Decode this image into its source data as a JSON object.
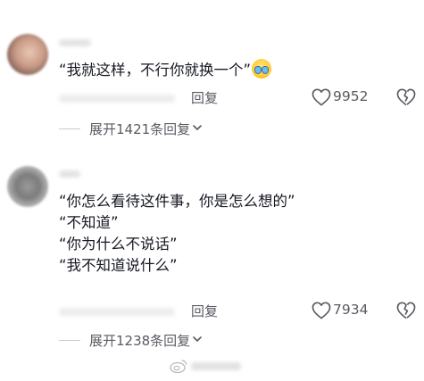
{
  "comments": [
    {
      "content_lines": [
        "“我就这样，不行你就换一个”"
      ],
      "emoji_icon": "crying-face-emoji",
      "reply_label": "回复",
      "like_count": "9952",
      "expand_label": "展开1421条回复"
    },
    {
      "content_lines": [
        "“你怎么看待这件事，你是怎么想的”",
        "“不知道”",
        "“你为什么不说话”",
        "“我不知道说什么”"
      ],
      "reply_label": "回复",
      "like_count": "7934",
      "expand_label": "展开1238条回复"
    }
  ],
  "icons": {
    "like": "heart-outline-icon",
    "dislike": "broken-heart-icon",
    "expand": "chevron-down-icon",
    "watermark": "weibo-logo-icon"
  },
  "colors": {
    "text_primary": "#161823",
    "text_secondary": "#5a5b63",
    "divider": "#c9cad0",
    "background": "#ffffff"
  }
}
